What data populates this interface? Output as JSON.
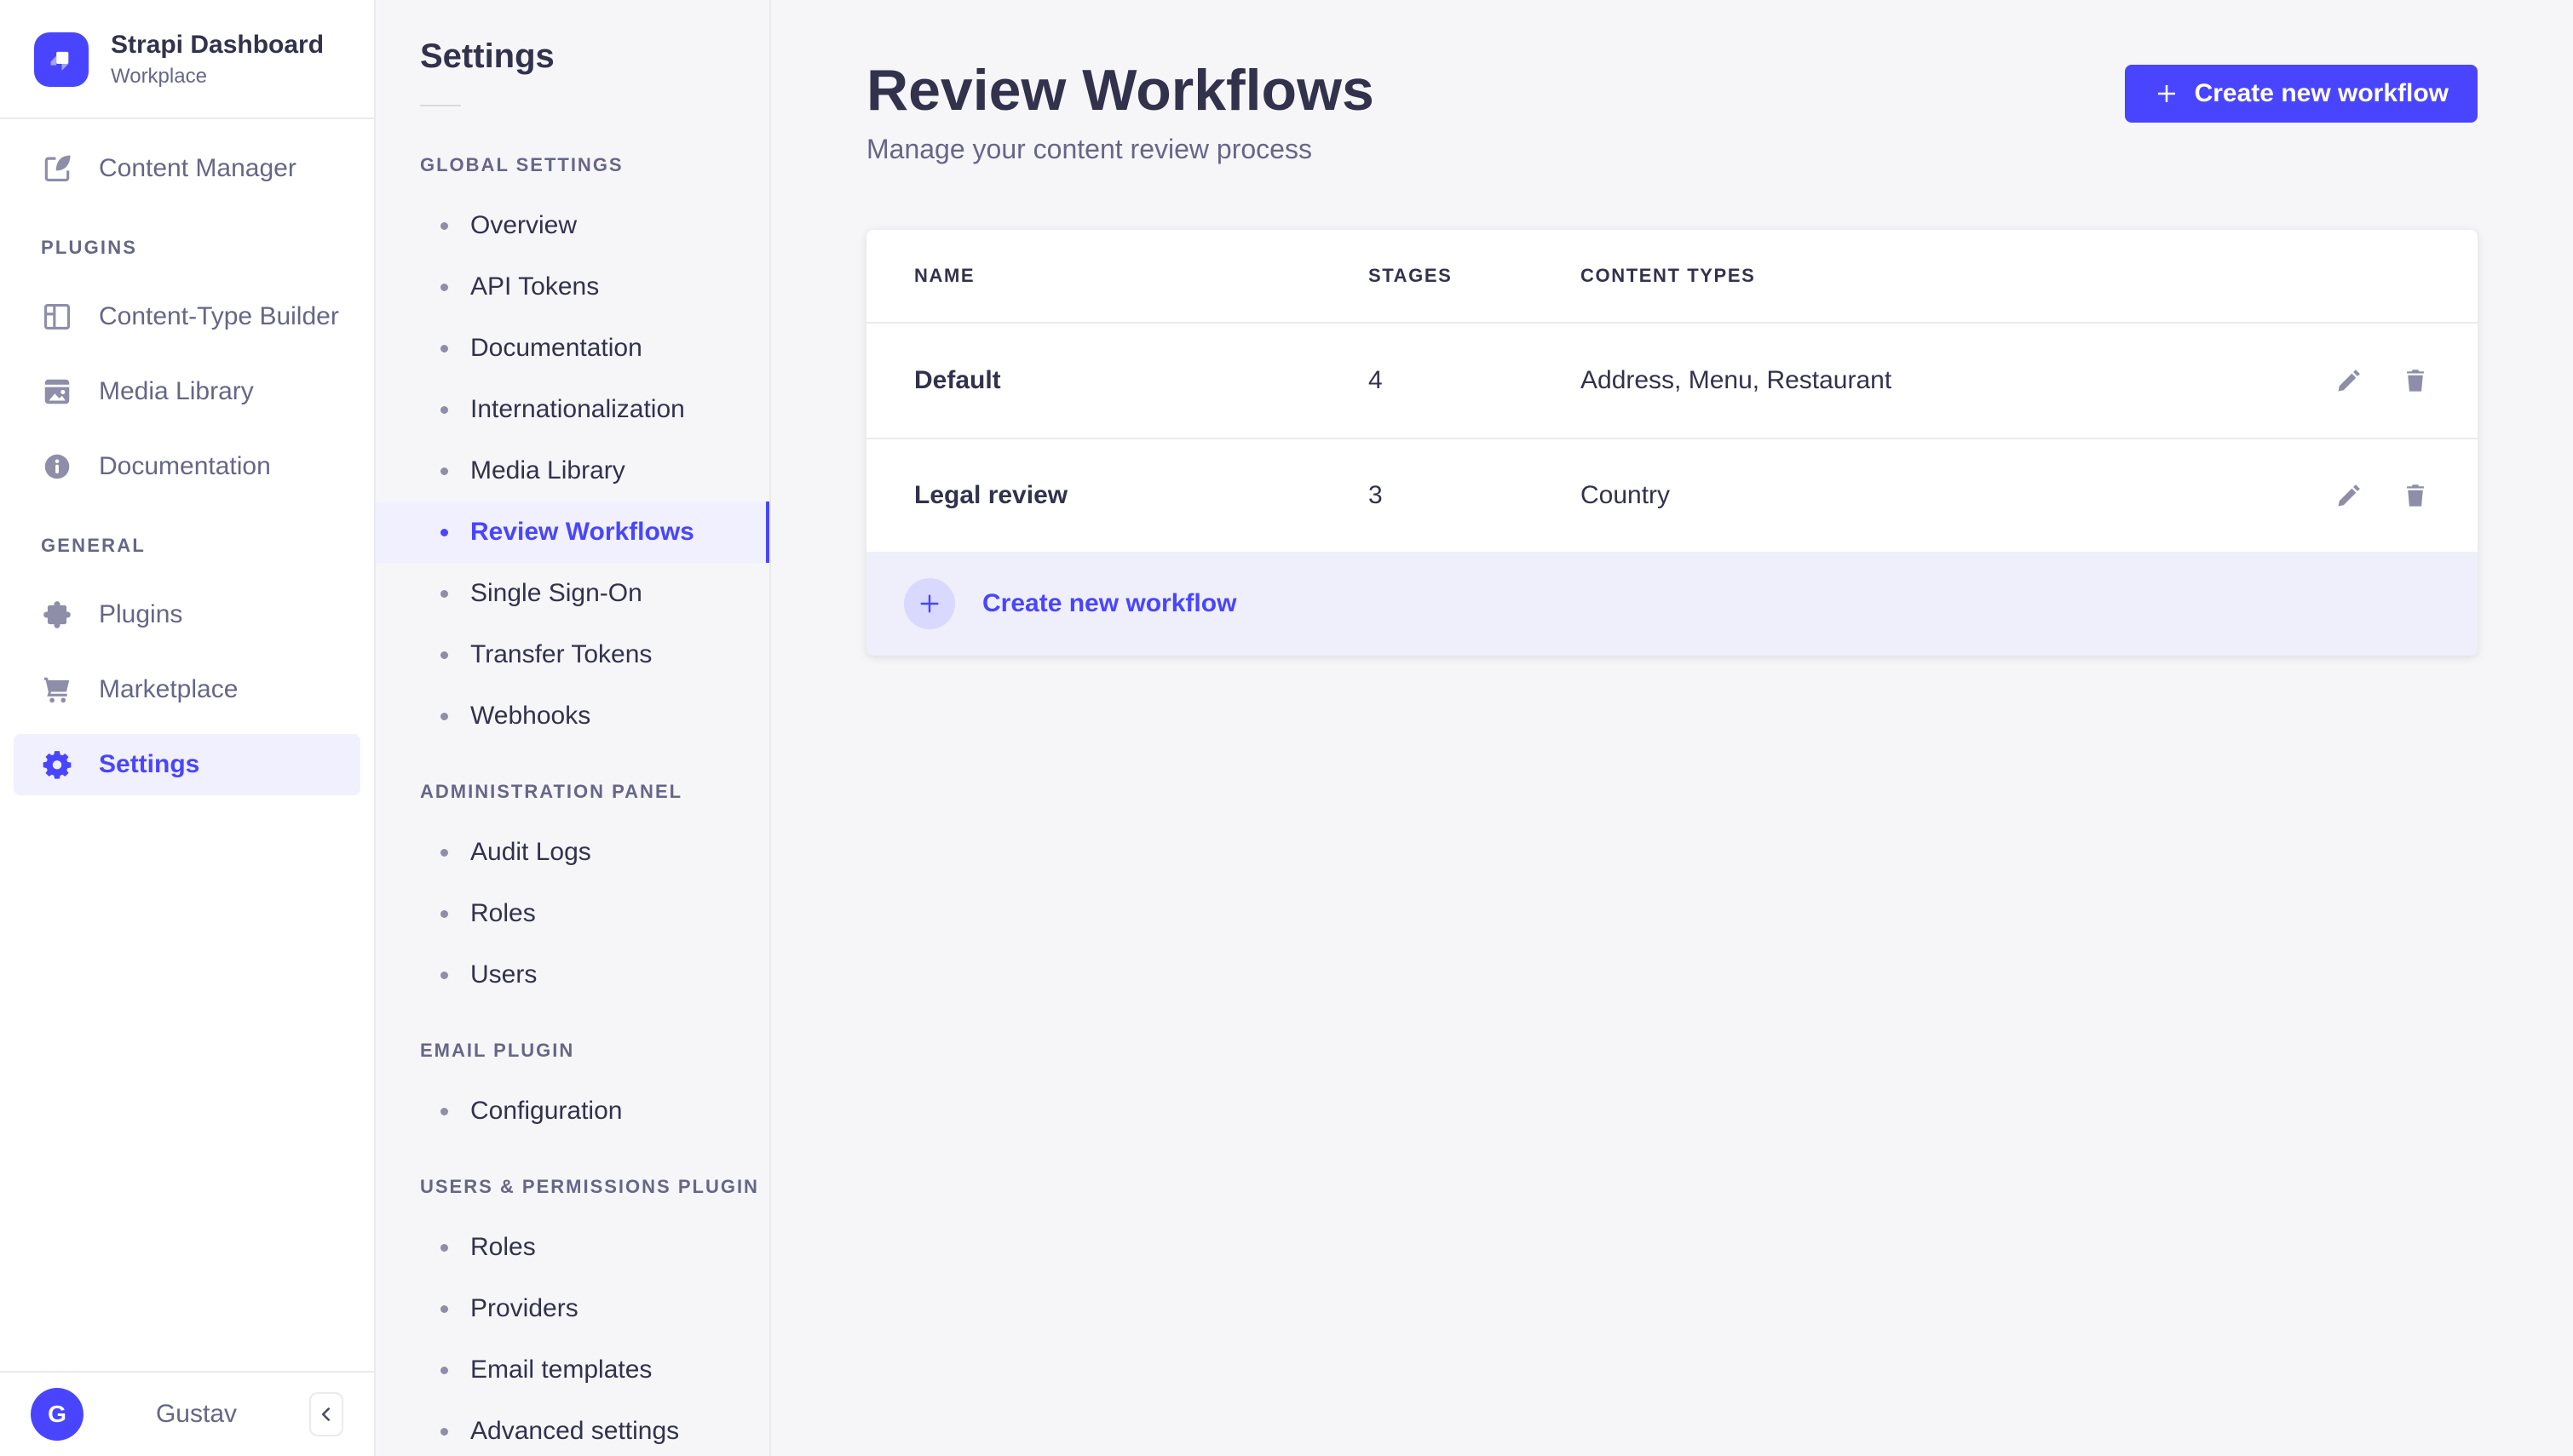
{
  "app": {
    "name": "Strapi Dashboard",
    "workspace": "Workplace",
    "user": {
      "initial": "G",
      "name": "Gustav"
    }
  },
  "colors": {
    "accent": "#4945FF",
    "accent_bg": "#F0F0FF",
    "text_dark": "#32324D",
    "text_muted": "#666687",
    "icon_gray": "#8E8EA9",
    "border": "#EAEAEF",
    "page_bg": "#F6F6F9",
    "footer_bg": "#EFEFFB",
    "plus_circle_bg": "#D9D8FF"
  },
  "main_nav": {
    "primary": [
      {
        "label": "Content Manager",
        "icon": "pen-square-icon",
        "active": false
      }
    ],
    "sections": [
      {
        "label": "Plugins",
        "items": [
          {
            "label": "Content-Type Builder",
            "icon": "layout-grid-icon",
            "active": false
          },
          {
            "label": "Media Library",
            "icon": "picture-icon",
            "active": false
          },
          {
            "label": "Documentation",
            "icon": "info-circle-icon",
            "active": false
          }
        ]
      },
      {
        "label": "General",
        "items": [
          {
            "label": "Plugins",
            "icon": "puzzle-icon",
            "active": false
          },
          {
            "label": "Marketplace",
            "icon": "shopping-cart-icon",
            "active": false
          },
          {
            "label": "Settings",
            "icon": "gear-icon",
            "active": true
          }
        ]
      }
    ],
    "collapse_icon": "chevron-left-icon"
  },
  "settings_nav": {
    "title": "Settings",
    "sections": [
      {
        "label": "Global Settings",
        "items": [
          {
            "label": "Overview",
            "active": false
          },
          {
            "label": "API Tokens",
            "active": false
          },
          {
            "label": "Documentation",
            "active": false
          },
          {
            "label": "Internationalization",
            "active": false
          },
          {
            "label": "Media Library",
            "active": false
          },
          {
            "label": "Review Workflows",
            "active": true
          },
          {
            "label": "Single Sign-On",
            "active": false
          },
          {
            "label": "Transfer Tokens",
            "active": false
          },
          {
            "label": "Webhooks",
            "active": false
          }
        ]
      },
      {
        "label": "Administration Panel",
        "items": [
          {
            "label": "Audit Logs",
            "active": false
          },
          {
            "label": "Roles",
            "active": false
          },
          {
            "label": "Users",
            "active": false
          }
        ]
      },
      {
        "label": "Email Plugin",
        "items": [
          {
            "label": "Configuration",
            "active": false
          }
        ]
      },
      {
        "label": "Users & Permissions plugin",
        "items": [
          {
            "label": "Roles",
            "active": false
          },
          {
            "label": "Providers",
            "active": false
          },
          {
            "label": "Email templates",
            "active": false
          },
          {
            "label": "Advanced settings",
            "active": false
          }
        ]
      }
    ]
  },
  "header": {
    "title": "Review Workflows",
    "subtitle": "Manage your content review process",
    "create_button": "Create new workflow"
  },
  "table": {
    "columns": {
      "name": "Name",
      "stages": "Stages",
      "content_types": "Content Types"
    },
    "rows": [
      {
        "name": "Default",
        "stages": "4",
        "content_types": "Address, Menu, Restaurant",
        "actions": [
          "edit",
          "delete"
        ]
      },
      {
        "name": "Legal review",
        "stages": "3",
        "content_types": "Country",
        "actions": [
          "edit",
          "delete"
        ]
      }
    ],
    "footer_action": "Create new workflow"
  }
}
